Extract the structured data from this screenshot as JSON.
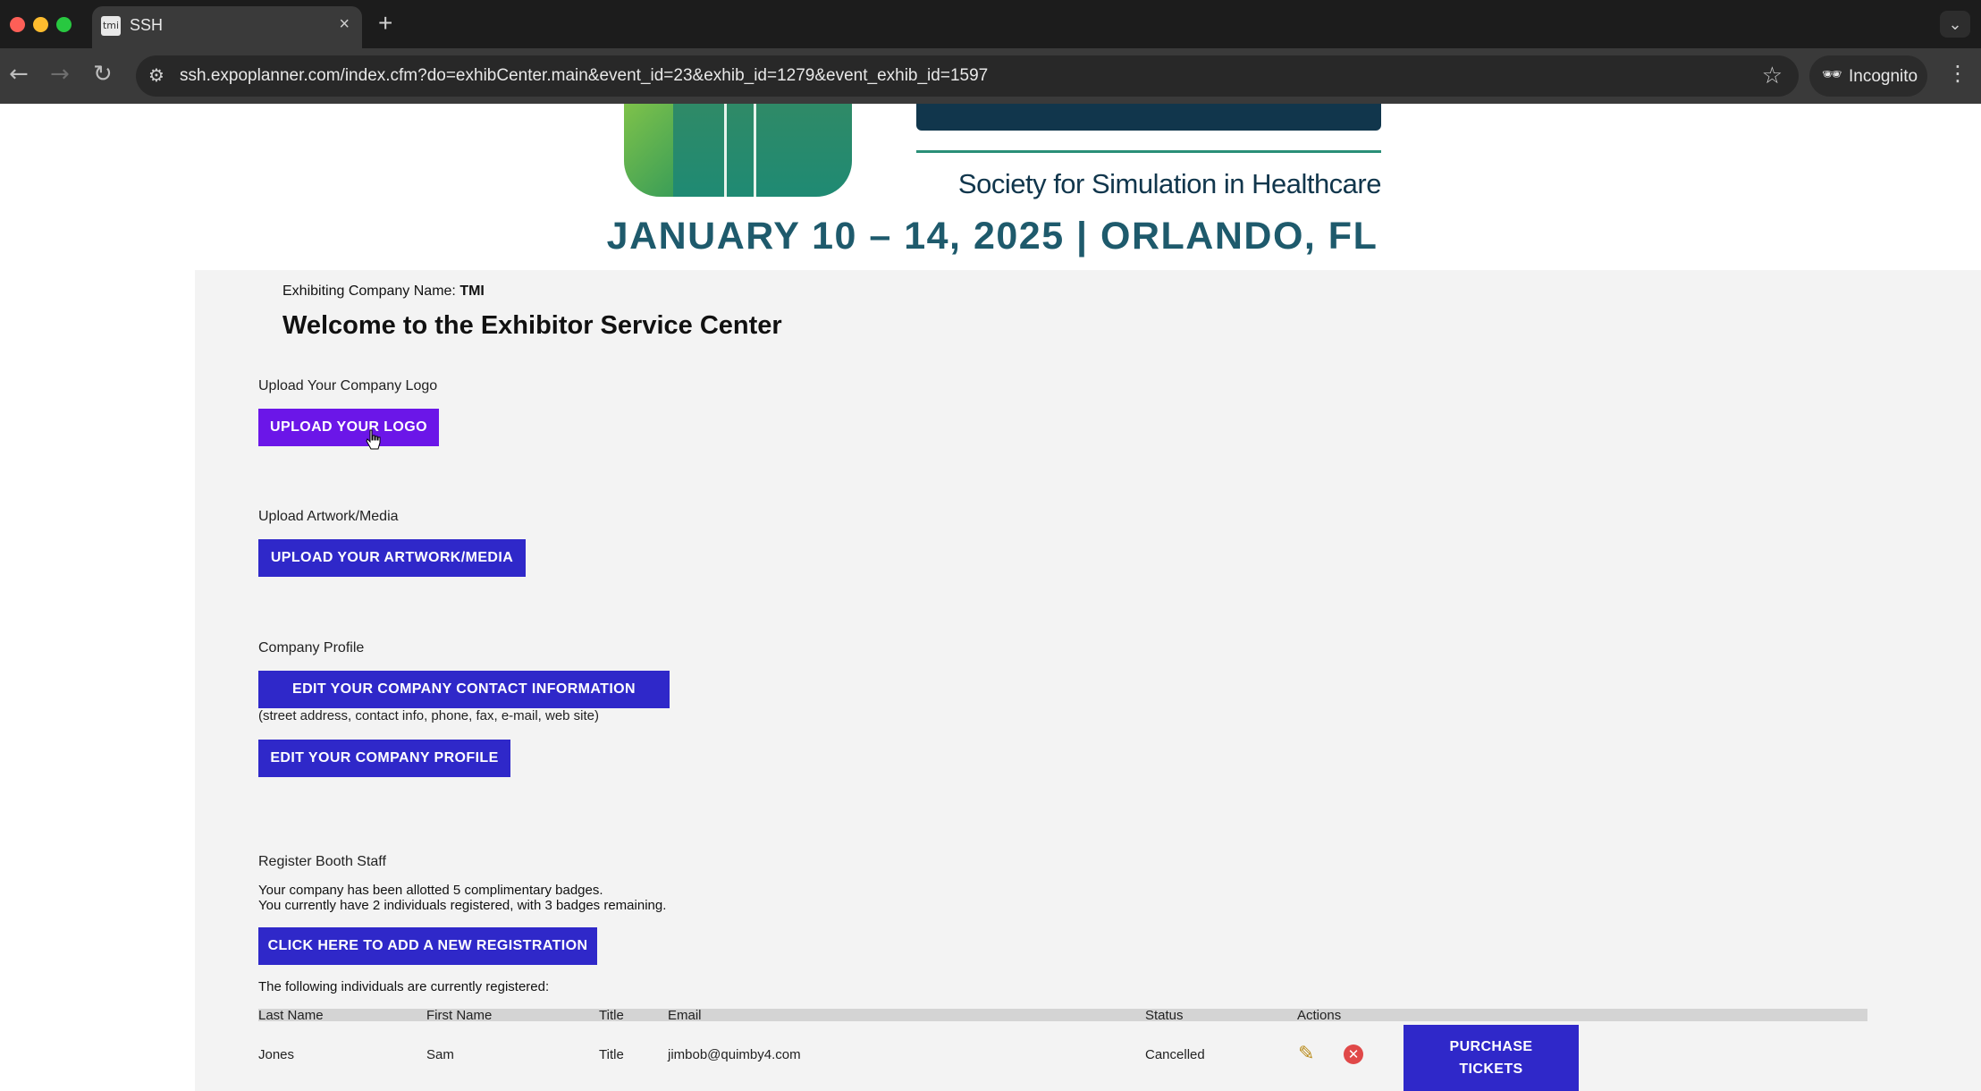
{
  "browser": {
    "tab_title": "SSH",
    "favicon_text": "tmi",
    "url": "ssh.expoplanner.com/index.cfm?do=exhibCenter.main&event_id=23&exhib_id=1279&event_exhib_id=1597",
    "incognito_label": "Incognito"
  },
  "header": {
    "society_name": "Society for Simulation in Healthcare",
    "event_dates": "JANUARY 10 – 14, 2025  |  ORLANDO, FL"
  },
  "company": {
    "label": "Exhibiting Company Name:",
    "name": "TMI"
  },
  "welcome_title": "Welcome to the Exhibitor Service Center",
  "sections": {
    "logo": {
      "label": "Upload Your Company Logo",
      "button": "UPLOAD YOUR LOGO"
    },
    "artwork": {
      "label": "Upload Artwork/Media",
      "button": "UPLOAD YOUR ARTWORK/MEDIA"
    },
    "profile": {
      "label": "Company Profile",
      "contact_button": "EDIT YOUR COMPANY CONTACT INFORMATION",
      "contact_hint": "(street address, contact info, phone, fax, e-mail, web site)",
      "profile_button": "EDIT YOUR COMPANY PROFILE"
    },
    "staff": {
      "label": "Register Booth Staff",
      "allotment_line1": "Your company has been allotted 5 complimentary badges.",
      "allotment_line2": "You currently have 2 individuals registered, with 3 badges remaining.",
      "add_button": "CLICK HERE TO ADD A NEW REGISTRATION",
      "table_intro": "The following individuals are currently registered:"
    }
  },
  "table": {
    "columns": [
      "Last Name",
      "First Name",
      "Title",
      "Email",
      "Status",
      "Actions"
    ],
    "rows": [
      {
        "last_name": "Jones",
        "first_name": "Sam",
        "title": "Title",
        "email": "jimbob@quimby4.com",
        "status": "Cancelled"
      }
    ],
    "purchase_line1": "PURCHASE",
    "purchase_line2": "TICKETS"
  },
  "colors": {
    "primary_button": "#2f28c9",
    "hovered_button": "#6b16e8",
    "brand_navy": "#11364c",
    "brand_teal": "#1e5a6c"
  }
}
